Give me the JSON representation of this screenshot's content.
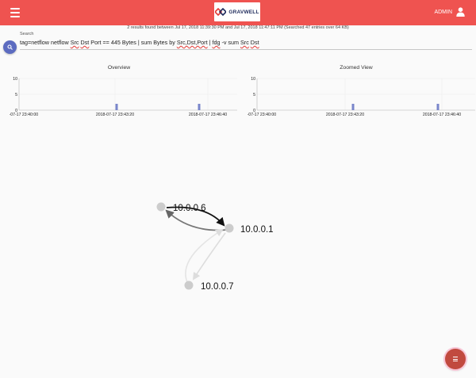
{
  "header": {
    "menu_icon": "hamburger-icon",
    "logo_text": "GRAVWELL",
    "user_label": "ADMIN",
    "user_icon": "user-icon",
    "bar_color": "#ef5350"
  },
  "results_summary": "2 results found between Jul 17, 2018 11:39:30 PM and Jul 17, 2018 11:47:11 PM (Searched 47 entries over 64 KB)",
  "search": {
    "label": "Search",
    "query_parts": [
      "tag=netflow netflow ",
      "Src",
      " ",
      "Dst",
      " Port == 445 Bytes | sum Bytes by ",
      "Src,Dst,Port",
      " | ",
      "fdg",
      " -v sum ",
      "Src",
      " ",
      "Dst"
    ],
    "button_icon": "search-icon",
    "button_color": "#5c6bc0"
  },
  "overview": {
    "title": "Overview",
    "chart_data": {
      "type": "bar",
      "y_ticks": [
        "10",
        "5",
        "0"
      ],
      "ylim": [
        0,
        10
      ],
      "x_ticks": [
        "2018-07-17 23:40:00",
        "2018-07-17 23:43:20",
        "2018-07-17 23:46:40"
      ],
      "bars": [
        2,
        2
      ],
      "bar_color": "#7986cb"
    }
  },
  "zoomed": {
    "title": "Zoomed View",
    "chart_data": {
      "type": "bar",
      "y_ticks": [
        "10",
        "5",
        "0"
      ],
      "ylim": [
        0,
        10
      ],
      "x_ticks": [
        "2018-07-17 23:40:00",
        "2018-07-17 23:43:20",
        "2018-07-17 23:46:40"
      ],
      "bars": [
        2,
        2
      ],
      "bar_color": "#7986cb"
    }
  },
  "graph": {
    "nodes": [
      {
        "label": "10.0.0.6"
      },
      {
        "label": "10.0.0.1"
      },
      {
        "label": "10.0.0.7"
      }
    ]
  },
  "fab": {
    "icon": "menu-icon",
    "color": "#c14a3f"
  }
}
